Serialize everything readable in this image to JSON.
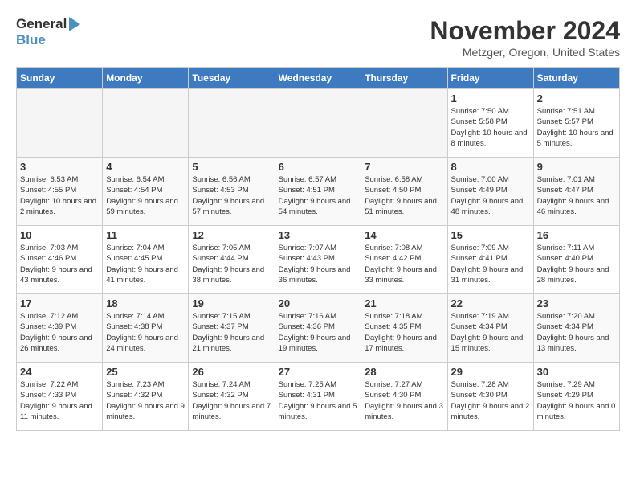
{
  "header": {
    "logo_line1": "General",
    "logo_line2": "Blue",
    "month": "November 2024",
    "location": "Metzger, Oregon, United States"
  },
  "days_of_week": [
    "Sunday",
    "Monday",
    "Tuesday",
    "Wednesday",
    "Thursday",
    "Friday",
    "Saturday"
  ],
  "weeks": [
    [
      {
        "day": "",
        "info": ""
      },
      {
        "day": "",
        "info": ""
      },
      {
        "day": "",
        "info": ""
      },
      {
        "day": "",
        "info": ""
      },
      {
        "day": "",
        "info": ""
      },
      {
        "day": "1",
        "info": "Sunrise: 7:50 AM\nSunset: 5:58 PM\nDaylight: 10 hours\nand 8 minutes."
      },
      {
        "day": "2",
        "info": "Sunrise: 7:51 AM\nSunset: 5:57 PM\nDaylight: 10 hours\nand 5 minutes."
      }
    ],
    [
      {
        "day": "3",
        "info": "Sunrise: 6:53 AM\nSunset: 4:55 PM\nDaylight: 10 hours\nand 2 minutes."
      },
      {
        "day": "4",
        "info": "Sunrise: 6:54 AM\nSunset: 4:54 PM\nDaylight: 9 hours\nand 59 minutes."
      },
      {
        "day": "5",
        "info": "Sunrise: 6:56 AM\nSunset: 4:53 PM\nDaylight: 9 hours\nand 57 minutes."
      },
      {
        "day": "6",
        "info": "Sunrise: 6:57 AM\nSunset: 4:51 PM\nDaylight: 9 hours\nand 54 minutes."
      },
      {
        "day": "7",
        "info": "Sunrise: 6:58 AM\nSunset: 4:50 PM\nDaylight: 9 hours\nand 51 minutes."
      },
      {
        "day": "8",
        "info": "Sunrise: 7:00 AM\nSunset: 4:49 PM\nDaylight: 9 hours\nand 48 minutes."
      },
      {
        "day": "9",
        "info": "Sunrise: 7:01 AM\nSunset: 4:47 PM\nDaylight: 9 hours\nand 46 minutes."
      }
    ],
    [
      {
        "day": "10",
        "info": "Sunrise: 7:03 AM\nSunset: 4:46 PM\nDaylight: 9 hours\nand 43 minutes."
      },
      {
        "day": "11",
        "info": "Sunrise: 7:04 AM\nSunset: 4:45 PM\nDaylight: 9 hours\nand 41 minutes."
      },
      {
        "day": "12",
        "info": "Sunrise: 7:05 AM\nSunset: 4:44 PM\nDaylight: 9 hours\nand 38 minutes."
      },
      {
        "day": "13",
        "info": "Sunrise: 7:07 AM\nSunset: 4:43 PM\nDaylight: 9 hours\nand 36 minutes."
      },
      {
        "day": "14",
        "info": "Sunrise: 7:08 AM\nSunset: 4:42 PM\nDaylight: 9 hours\nand 33 minutes."
      },
      {
        "day": "15",
        "info": "Sunrise: 7:09 AM\nSunset: 4:41 PM\nDaylight: 9 hours\nand 31 minutes."
      },
      {
        "day": "16",
        "info": "Sunrise: 7:11 AM\nSunset: 4:40 PM\nDaylight: 9 hours\nand 28 minutes."
      }
    ],
    [
      {
        "day": "17",
        "info": "Sunrise: 7:12 AM\nSunset: 4:39 PM\nDaylight: 9 hours\nand 26 minutes."
      },
      {
        "day": "18",
        "info": "Sunrise: 7:14 AM\nSunset: 4:38 PM\nDaylight: 9 hours\nand 24 minutes."
      },
      {
        "day": "19",
        "info": "Sunrise: 7:15 AM\nSunset: 4:37 PM\nDaylight: 9 hours\nand 21 minutes."
      },
      {
        "day": "20",
        "info": "Sunrise: 7:16 AM\nSunset: 4:36 PM\nDaylight: 9 hours\nand 19 minutes."
      },
      {
        "day": "21",
        "info": "Sunrise: 7:18 AM\nSunset: 4:35 PM\nDaylight: 9 hours\nand 17 minutes."
      },
      {
        "day": "22",
        "info": "Sunrise: 7:19 AM\nSunset: 4:34 PM\nDaylight: 9 hours\nand 15 minutes."
      },
      {
        "day": "23",
        "info": "Sunrise: 7:20 AM\nSunset: 4:34 PM\nDaylight: 9 hours\nand 13 minutes."
      }
    ],
    [
      {
        "day": "24",
        "info": "Sunrise: 7:22 AM\nSunset: 4:33 PM\nDaylight: 9 hours\nand 11 minutes."
      },
      {
        "day": "25",
        "info": "Sunrise: 7:23 AM\nSunset: 4:32 PM\nDaylight: 9 hours\nand 9 minutes."
      },
      {
        "day": "26",
        "info": "Sunrise: 7:24 AM\nSunset: 4:32 PM\nDaylight: 9 hours\nand 7 minutes."
      },
      {
        "day": "27",
        "info": "Sunrise: 7:25 AM\nSunset: 4:31 PM\nDaylight: 9 hours\nand 5 minutes."
      },
      {
        "day": "28",
        "info": "Sunrise: 7:27 AM\nSunset: 4:30 PM\nDaylight: 9 hours\nand 3 minutes."
      },
      {
        "day": "29",
        "info": "Sunrise: 7:28 AM\nSunset: 4:30 PM\nDaylight: 9 hours\nand 2 minutes."
      },
      {
        "day": "30",
        "info": "Sunrise: 7:29 AM\nSunset: 4:29 PM\nDaylight: 9 hours\nand 0 minutes."
      }
    ]
  ]
}
